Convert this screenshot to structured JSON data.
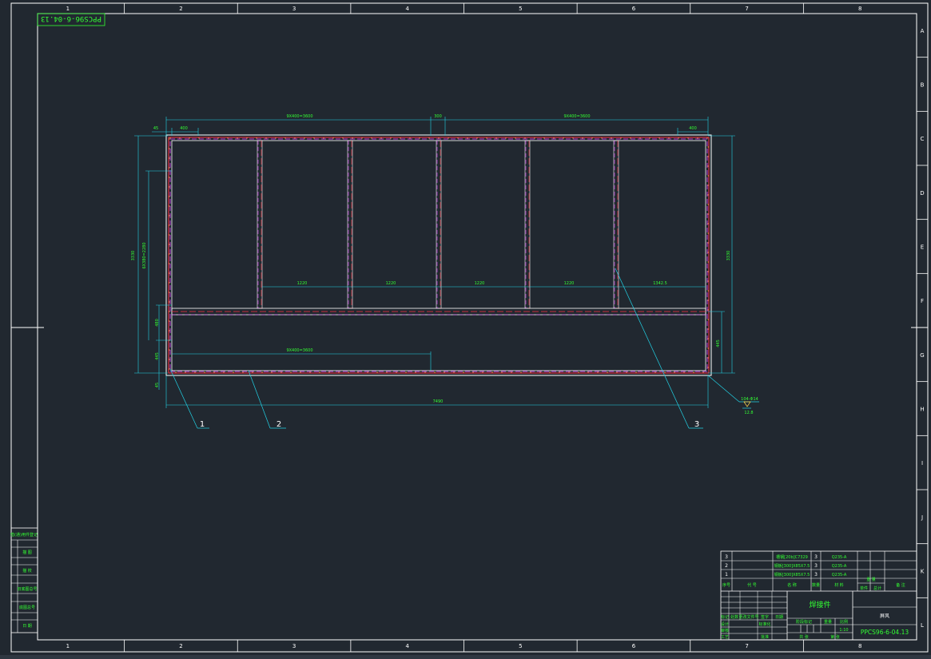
{
  "grid": {
    "columns": [
      "1",
      "2",
      "3",
      "4",
      "5",
      "6",
      "7",
      "8"
    ],
    "rows": [
      "A",
      "B",
      "C",
      "D",
      "E",
      "F",
      "G",
      "H",
      "I",
      "J",
      "K",
      "L"
    ]
  },
  "drawing_stamp": "PPCS96-6-04.13",
  "dimensions": {
    "top_left_45": "45",
    "top_left_400": "400",
    "top_span_left": "9X400=3600",
    "top_span_mid": "300",
    "top_span_right": "9X400=3600",
    "top_right_400": "400",
    "left_total": "3330",
    "left_spacing": "6X380=2280",
    "left_480": "480",
    "left_445": "445",
    "left_45": "45",
    "right_total": "3330",
    "right_445": "445",
    "inner_1220_a": "1220",
    "inner_1220_b": "1220",
    "inner_1220_c": "1220",
    "inner_1220_d": "1220",
    "inner_1342": "1342.5",
    "bottom_span": "9X400=3600",
    "overall_width": "7490",
    "weld_symbol": "104-Φ14",
    "weld_size": "12.8"
  },
  "callouts": [
    "1",
    "2",
    "3"
  ],
  "side_block": {
    "rows": [
      "借(通)用件登记",
      "描 图",
      "描 校",
      "旧底图总号",
      "底图总号",
      "签 字",
      "日 期"
    ]
  },
  "title_block": {
    "parts": [
      {
        "no": "3",
        "spec": "槽钢[20b]C7329",
        "qty": "3",
        "material": "Q235-A"
      },
      {
        "no": "2",
        "spec": "钢板[300]X85X7.5",
        "qty": "3",
        "material": "Q235-A"
      },
      {
        "no": "1",
        "spec": "钢板[300]X85X7.5",
        "qty": "3",
        "material": "Q235-A"
      }
    ],
    "header": {
      "no": "序号",
      "code": "代 号",
      "name": "名 称",
      "qty": "数量",
      "material": "材 料",
      "unit_weight": "单件",
      "total_weight": "总计",
      "weight": "重 量",
      "remark": "备 注"
    },
    "part_name": "焊接件",
    "assembly": "屏风",
    "drawing_code": "PPCS96-6-04.13",
    "scale": "1:10",
    "labels": {
      "mark": "标记",
      "count": "处数",
      "change_doc": "更改文件号",
      "sign": "签字",
      "date": "日期",
      "stage": "阶段标记",
      "weight": "重量",
      "ratio": "比例",
      "design": "设计",
      "standard": "标准化",
      "check": "审核",
      "process": "工艺",
      "approve": "批准",
      "sheet_total": "共 张",
      "sheet_no": "第 张"
    }
  },
  "colors": {
    "background": "#212830",
    "line_white": "#ffffff",
    "line_cyan": "#22d3e6",
    "text_green": "#33ff33",
    "frame_red": "#ff3040",
    "dash_magenta": "#e040ff",
    "dash_yellow": "#ffd84a"
  }
}
